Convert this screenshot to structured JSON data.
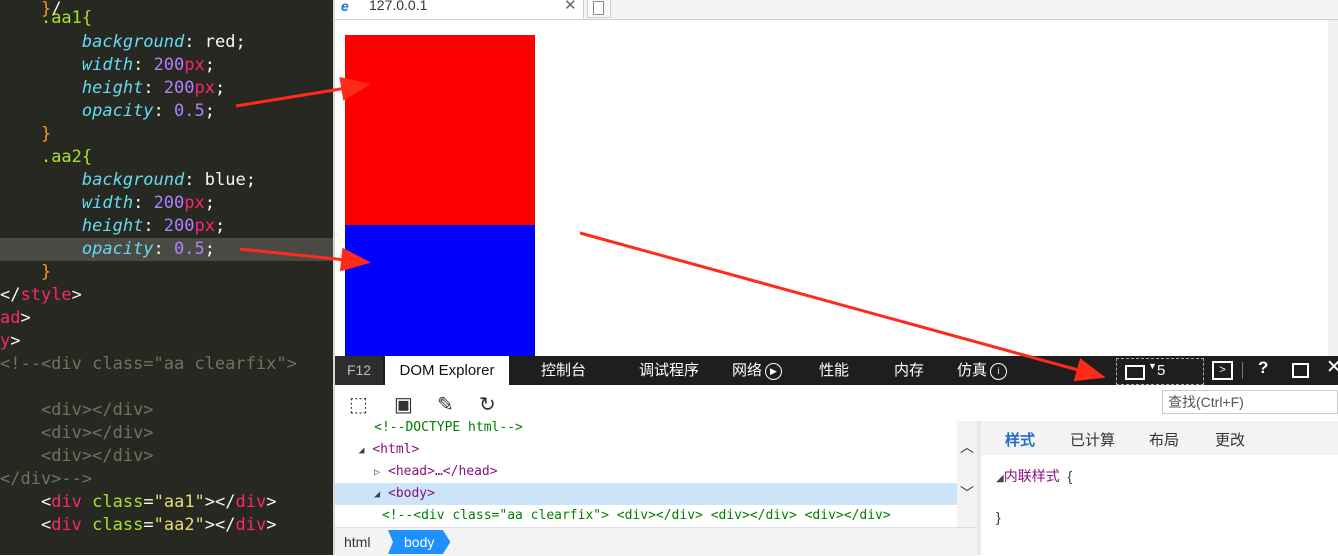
{
  "editor": {
    "lines": {
      "l1": ".aa1{",
      "l2_prop": "background",
      "l2_val": "red",
      "l3_prop": "width",
      "l3_num": "200",
      "l3_unit": "px",
      "l4_prop": "height",
      "l4_num": "200",
      "l4_unit": "px",
      "l5_prop": "opacity",
      "l5_num": "0.5",
      "l6": "}",
      "l7": ".aa2{",
      "l8_prop": "background",
      "l8_val": "blue",
      "l9_prop": "width",
      "l9_num": "200",
      "l9_unit": "px",
      "l10_prop": "height",
      "l10_num": "200",
      "l10_unit": "px",
      "l11_prop": "opacity",
      "l11_num": "0.5",
      "l12": "}",
      "l13_tag": "style",
      "l14": "ad",
      "l15": "y",
      "l16": "<!--<div class=\"aa clearfix\">",
      "l17": "<div></div>",
      "l18": "<div></div>",
      "l19": "<div></div>",
      "l20": "</div>-->",
      "l21_class": "\"aa1\"",
      "l22_class": "\"aa2\""
    }
  },
  "browser": {
    "tab_title": "127.0.0.1",
    "close_glyph": "✕",
    "ie_glyph": "e",
    "box_colors": {
      "aa1": "#ff0000",
      "aa2": "#0000ff"
    }
  },
  "devtools": {
    "tabs": {
      "f12": "F12",
      "dom": "DOM Explorer",
      "console": "控制台",
      "debugger": "调试程序",
      "network": "网络",
      "performance": "性能",
      "memory": "内存",
      "emulation": "仿真"
    },
    "target_number": "5",
    "find_placeholder": "查找(Ctrl+F)",
    "dom_tree": {
      "doctype": "<!--DOCTYPE html-->",
      "html": "<html>",
      "head": "<head>…</head>",
      "body": "<body>",
      "comment": "<!--<div class=\"aa clearfix\"> <div></div> <div></div> <div></div>"
    },
    "breadcrumb": {
      "html": "html",
      "body": "body"
    },
    "styles": {
      "tabs": {
        "styles": "样式",
        "computed": "已计算",
        "layout": "布局",
        "changes": "更改"
      },
      "inline_label": "内联样式",
      "open_brace": "{",
      "close_brace": "}"
    }
  }
}
